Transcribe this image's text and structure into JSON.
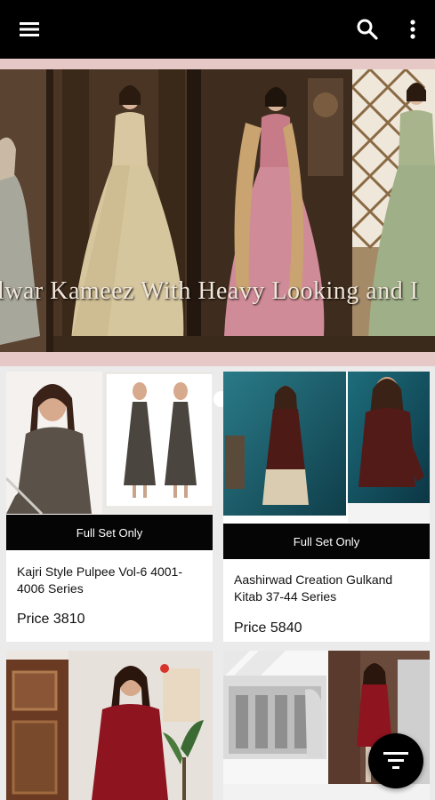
{
  "appbar": {
    "menu_icon": "hamburger-menu-icon",
    "search_icon": "search-icon",
    "more_icon": "more-vertical-icon"
  },
  "banner": {
    "caption": "lwar Kameez With Heavy Looking and I",
    "slides_total": 2,
    "active_slide": 2
  },
  "products": [
    {
      "button_label": "Full Set Only",
      "title": "Kajri Style Pulpee Vol-6 4001-4006 Series",
      "price": "Price 3810"
    },
    {
      "button_label": "Full Set Only",
      "title": "Aashirwad Creation Gulkand Kitab 37-44 Series",
      "price": "Price 5840"
    },
    {
      "button_label": "",
      "title": "",
      "price": ""
    },
    {
      "button_label": "",
      "title": "",
      "price": ""
    }
  ],
  "fab": {
    "icon": "filter-icon"
  },
  "colors": {
    "appbar": "#000000",
    "banner_border": "#e6c9c7",
    "button": "#050505",
    "background": "#ebebeb"
  }
}
